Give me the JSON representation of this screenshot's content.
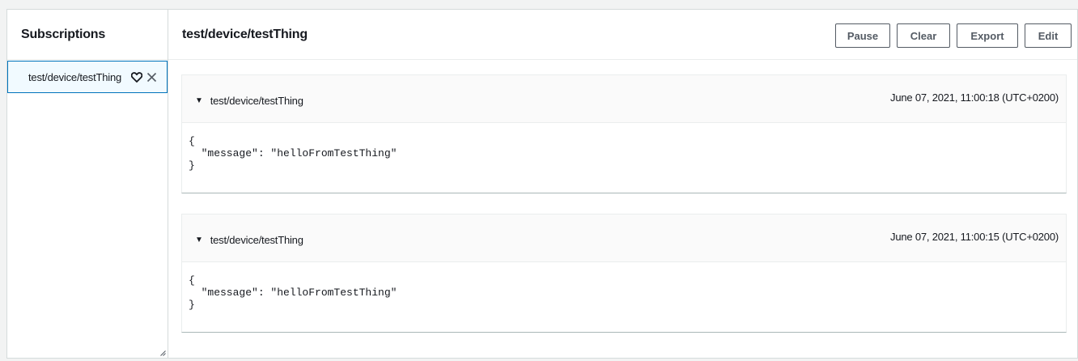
{
  "sidebar": {
    "title": "Subscriptions",
    "items": [
      {
        "label": "test/device/testThing",
        "favorite_icon": "heart-icon",
        "close_icon": "close-icon"
      }
    ]
  },
  "main": {
    "title": "test/device/testThing",
    "toolbar": {
      "pause_label": "Pause",
      "clear_label": "Clear",
      "export_label": "Export",
      "edit_label": "Edit"
    },
    "messages": [
      {
        "topic": "test/device/testThing",
        "timestamp": "June 07, 2021, 11:00:18 (UTC+0200)",
        "payload": "{\n  \"message\": \"helloFromTestThing\"\n}"
      },
      {
        "topic": "test/device/testThing",
        "timestamp": "June 07, 2021, 11:00:15 (UTC+0200)",
        "payload": "{\n  \"message\": \"helloFromTestThing\"\n}"
      }
    ]
  },
  "colors": {
    "selected_bg": "#f1faff",
    "selected_border": "#0073bb",
    "button_border": "#545b64"
  }
}
